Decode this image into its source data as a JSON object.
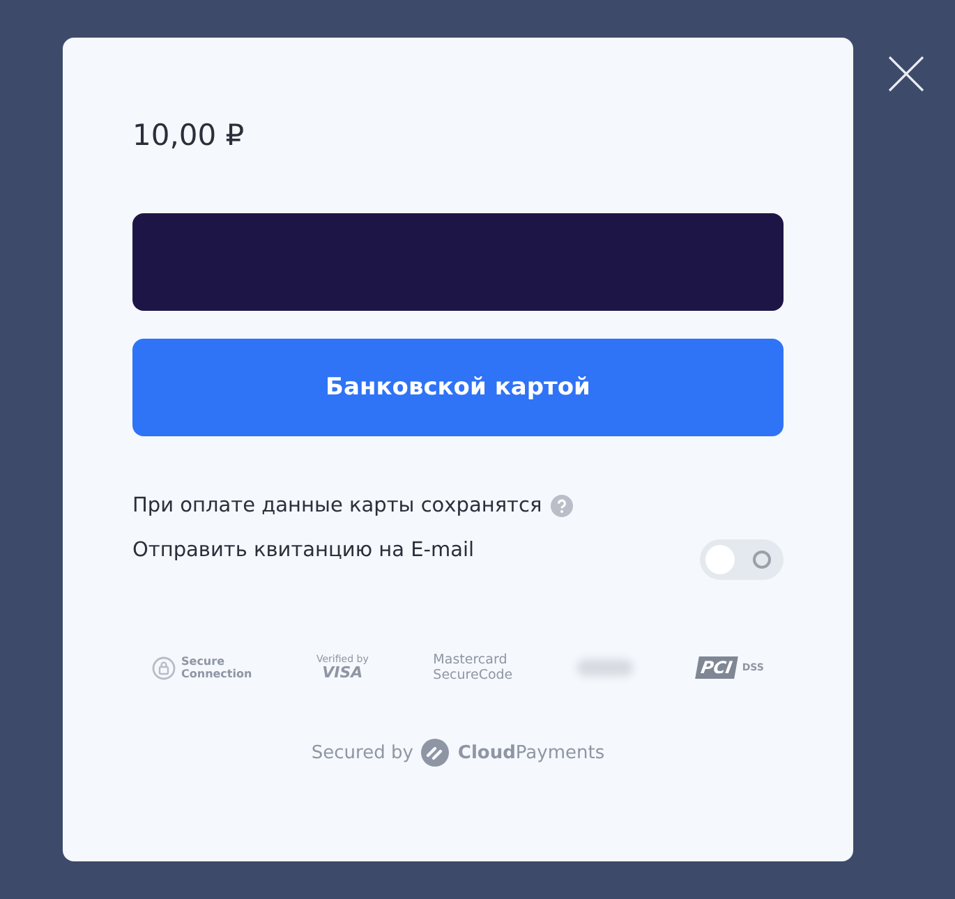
{
  "amount": "10,00 ₽",
  "wallet_button": {
    "kind": "dark"
  },
  "card_button": {
    "label": "Банковской картой"
  },
  "save_note": {
    "text": "При оплате данные карты сохранятся"
  },
  "receipt": {
    "label": "Отправить квитанцию на E-mail",
    "on": false
  },
  "badges": [
    {
      "kind": "lock",
      "lines": [
        "Secure",
        "Connection"
      ]
    },
    {
      "kind": "visa",
      "lines": [
        "Verified by",
        "VISA"
      ]
    },
    {
      "kind": "plain",
      "lines": [
        "Mastercard",
        "SecureCode"
      ]
    },
    {
      "kind": "blur"
    },
    {
      "kind": "pci",
      "lines": [
        "PCI",
        "DSS"
      ]
    }
  ],
  "footer": {
    "prefix": "Secured by",
    "brand_bold": "Cloud",
    "brand_rest": "Payments"
  }
}
